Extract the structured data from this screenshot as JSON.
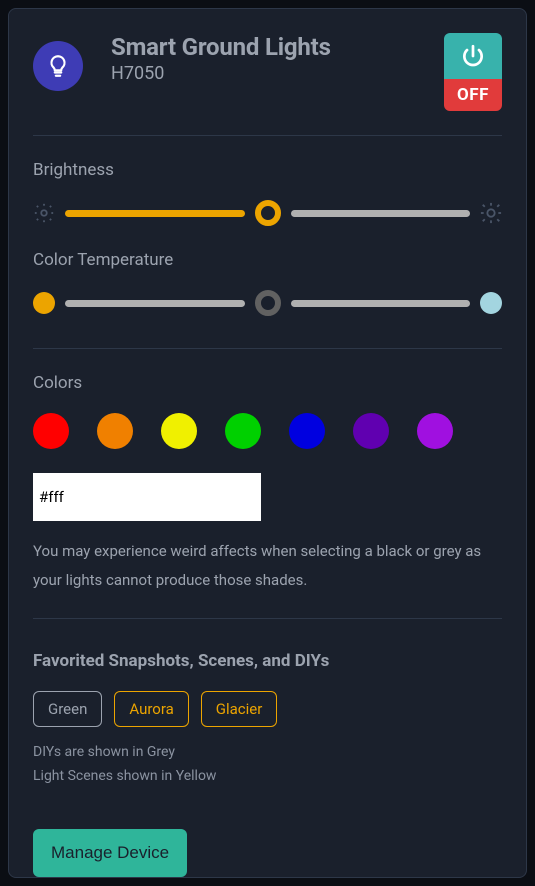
{
  "header": {
    "title": "Smart Ground Lights",
    "model": "H7050",
    "power_state": "OFF"
  },
  "brightness": {
    "label": "Brightness",
    "value_percent": 50
  },
  "color_temperature": {
    "label": "Color Temperature",
    "value_percent": 50
  },
  "colors": {
    "label": "Colors",
    "presets": [
      {
        "name": "red",
        "hex": "#FF0000"
      },
      {
        "name": "orange",
        "hex": "#F08000"
      },
      {
        "name": "yellow",
        "hex": "#F0F000"
      },
      {
        "name": "green",
        "hex": "#00D000"
      },
      {
        "name": "blue",
        "hex": "#0000E0"
      },
      {
        "name": "violet",
        "hex": "#6000B0"
      },
      {
        "name": "magenta",
        "hex": "#A010E0"
      }
    ],
    "hex_input": "#fff",
    "hint": "You may experience weird affects when selecting a black or grey as your lights cannot produce those shades."
  },
  "favorites": {
    "label": "Favorited Snapshots, Scenes, and DIYs",
    "items": [
      {
        "label": "Green",
        "kind": "grey"
      },
      {
        "label": "Aurora",
        "kind": "yellow"
      },
      {
        "label": "Glacier",
        "kind": "yellow"
      }
    ],
    "legend_diy": "DIYs are shown in Grey",
    "legend_scene": "Light Scenes shown in Yellow"
  },
  "manage_button": "Manage Device"
}
